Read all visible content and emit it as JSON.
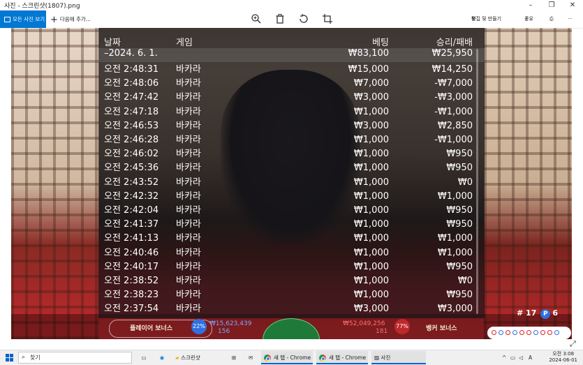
{
  "window": {
    "title": "사진 - 스크린샷(1807).png"
  },
  "toolbar": {
    "all_photos_label": "모든 사진 보기",
    "add_to_label": "다음에 추가...",
    "edit_create_label": "편집 및 만들기",
    "share_label": "공유",
    "more_label": "···"
  },
  "history": {
    "headers": {
      "date": "날짜",
      "game": "게임",
      "bet": "베팅",
      "winloss": "승리/패배"
    },
    "summary": {
      "date": "–2024. 6. 1.",
      "bet": "₩83,100",
      "winloss": "₩25,950"
    },
    "rows": [
      {
        "time": "오전 2:48:31",
        "game": "바카라",
        "bet": "₩15,000",
        "winloss": "₩14,250"
      },
      {
        "time": "오전 2:48:06",
        "game": "바카라",
        "bet": "₩7,000",
        "winloss": "-₩7,000"
      },
      {
        "time": "오전 2:47:42",
        "game": "바카라",
        "bet": "₩3,000",
        "winloss": "-₩3,000"
      },
      {
        "time": "오전 2:47:18",
        "game": "바카라",
        "bet": "₩1,000",
        "winloss": "-₩1,000"
      },
      {
        "time": "오전 2:46:53",
        "game": "바카라",
        "bet": "₩3,000",
        "winloss": "₩2,850"
      },
      {
        "time": "오전 2:46:28",
        "game": "바카라",
        "bet": "₩1,000",
        "winloss": "-₩1,000"
      },
      {
        "time": "오전 2:46:02",
        "game": "바카라",
        "bet": "₩1,000",
        "winloss": "₩950"
      },
      {
        "time": "오전 2:45:36",
        "game": "바카라",
        "bet": "₩1,000",
        "winloss": "₩950"
      },
      {
        "time": "오전 2:43:52",
        "game": "바카라",
        "bet": "₩1,000",
        "winloss": "₩0"
      },
      {
        "time": "오전 2:42:32",
        "game": "바카라",
        "bet": "₩1,000",
        "winloss": "₩1,000"
      },
      {
        "time": "오전 2:42:04",
        "game": "바카라",
        "bet": "₩1,000",
        "winloss": "₩950"
      },
      {
        "time": "오전 2:41:37",
        "game": "바카라",
        "bet": "₩1,000",
        "winloss": "₩950"
      },
      {
        "time": "오전 2:41:13",
        "game": "바카라",
        "bet": "₩1,000",
        "winloss": "₩1,000"
      },
      {
        "time": "오전 2:40:46",
        "game": "바카라",
        "bet": "₩1,000",
        "winloss": "₩1,000"
      },
      {
        "time": "오전 2:40:17",
        "game": "바카라",
        "bet": "₩1,000",
        "winloss": "₩950"
      },
      {
        "time": "오전 2:38:52",
        "game": "바카라",
        "bet": "₩1,000",
        "winloss": "₩0"
      },
      {
        "time": "오전 2:38:23",
        "game": "바카라",
        "bet": "₩1,000",
        "winloss": "₩950"
      },
      {
        "time": "오전 2:37:54",
        "game": "바카라",
        "bet": "₩3,000",
        "winloss": "₩3,000"
      }
    ]
  },
  "game_bar": {
    "player_bonus_label": "플레이어 보너스",
    "player_pct": "22%",
    "player_amount": "₩15,623,439",
    "player_count": "156",
    "banker_amount": "₩52,049,256",
    "banker_count": "181",
    "banker_pct": "77%",
    "banker_bonus_label": "뱅커 보너스",
    "round_number": "# 17",
    "p_badge": "P",
    "p_count": "6"
  },
  "taskbar": {
    "search_placeholder": "찾기",
    "apps": [
      {
        "label": "스크린샷"
      },
      {
        "label": "새 탭 - Chrome"
      },
      {
        "label": "새 탭 - Chrome"
      },
      {
        "label": "사진"
      }
    ],
    "tray_lang": "A",
    "clock_time": "오전 3:08",
    "clock_date": "2024-06-01"
  },
  "colors": {
    "accent": "#0078d4",
    "overlay": "#141416",
    "table_red": "#c12c30"
  }
}
